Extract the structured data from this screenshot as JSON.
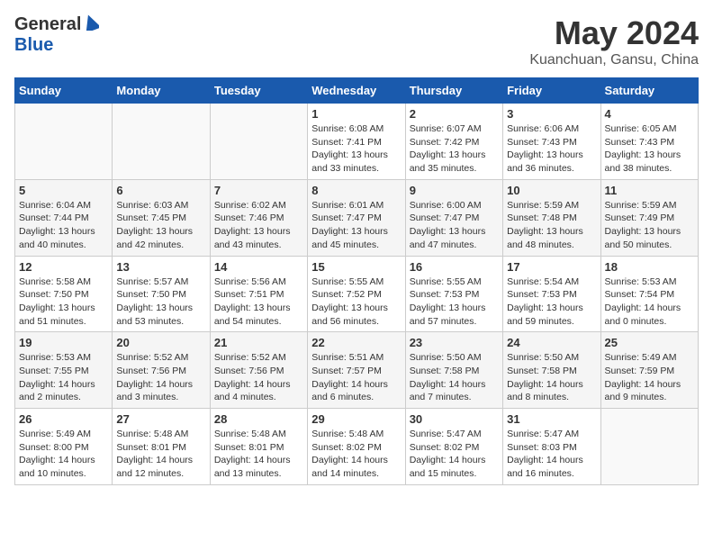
{
  "logo": {
    "general": "General",
    "blue": "Blue"
  },
  "title": {
    "month_year": "May 2024",
    "location": "Kuanchuan, Gansu, China"
  },
  "headers": [
    "Sunday",
    "Monday",
    "Tuesday",
    "Wednesday",
    "Thursday",
    "Friday",
    "Saturday"
  ],
  "weeks": [
    [
      {
        "day": "",
        "info": ""
      },
      {
        "day": "",
        "info": ""
      },
      {
        "day": "",
        "info": ""
      },
      {
        "day": "1",
        "info": "Sunrise: 6:08 AM\nSunset: 7:41 PM\nDaylight: 13 hours\nand 33 minutes."
      },
      {
        "day": "2",
        "info": "Sunrise: 6:07 AM\nSunset: 7:42 PM\nDaylight: 13 hours\nand 35 minutes."
      },
      {
        "day": "3",
        "info": "Sunrise: 6:06 AM\nSunset: 7:43 PM\nDaylight: 13 hours\nand 36 minutes."
      },
      {
        "day": "4",
        "info": "Sunrise: 6:05 AM\nSunset: 7:43 PM\nDaylight: 13 hours\nand 38 minutes."
      }
    ],
    [
      {
        "day": "5",
        "info": "Sunrise: 6:04 AM\nSunset: 7:44 PM\nDaylight: 13 hours\nand 40 minutes."
      },
      {
        "day": "6",
        "info": "Sunrise: 6:03 AM\nSunset: 7:45 PM\nDaylight: 13 hours\nand 42 minutes."
      },
      {
        "day": "7",
        "info": "Sunrise: 6:02 AM\nSunset: 7:46 PM\nDaylight: 13 hours\nand 43 minutes."
      },
      {
        "day": "8",
        "info": "Sunrise: 6:01 AM\nSunset: 7:47 PM\nDaylight: 13 hours\nand 45 minutes."
      },
      {
        "day": "9",
        "info": "Sunrise: 6:00 AM\nSunset: 7:47 PM\nDaylight: 13 hours\nand 47 minutes."
      },
      {
        "day": "10",
        "info": "Sunrise: 5:59 AM\nSunset: 7:48 PM\nDaylight: 13 hours\nand 48 minutes."
      },
      {
        "day": "11",
        "info": "Sunrise: 5:59 AM\nSunset: 7:49 PM\nDaylight: 13 hours\nand 50 minutes."
      }
    ],
    [
      {
        "day": "12",
        "info": "Sunrise: 5:58 AM\nSunset: 7:50 PM\nDaylight: 13 hours\nand 51 minutes."
      },
      {
        "day": "13",
        "info": "Sunrise: 5:57 AM\nSunset: 7:50 PM\nDaylight: 13 hours\nand 53 minutes."
      },
      {
        "day": "14",
        "info": "Sunrise: 5:56 AM\nSunset: 7:51 PM\nDaylight: 13 hours\nand 54 minutes."
      },
      {
        "day": "15",
        "info": "Sunrise: 5:55 AM\nSunset: 7:52 PM\nDaylight: 13 hours\nand 56 minutes."
      },
      {
        "day": "16",
        "info": "Sunrise: 5:55 AM\nSunset: 7:53 PM\nDaylight: 13 hours\nand 57 minutes."
      },
      {
        "day": "17",
        "info": "Sunrise: 5:54 AM\nSunset: 7:53 PM\nDaylight: 13 hours\nand 59 minutes."
      },
      {
        "day": "18",
        "info": "Sunrise: 5:53 AM\nSunset: 7:54 PM\nDaylight: 14 hours\nand 0 minutes."
      }
    ],
    [
      {
        "day": "19",
        "info": "Sunrise: 5:53 AM\nSunset: 7:55 PM\nDaylight: 14 hours\nand 2 minutes."
      },
      {
        "day": "20",
        "info": "Sunrise: 5:52 AM\nSunset: 7:56 PM\nDaylight: 14 hours\nand 3 minutes."
      },
      {
        "day": "21",
        "info": "Sunrise: 5:52 AM\nSunset: 7:56 PM\nDaylight: 14 hours\nand 4 minutes."
      },
      {
        "day": "22",
        "info": "Sunrise: 5:51 AM\nSunset: 7:57 PM\nDaylight: 14 hours\nand 6 minutes."
      },
      {
        "day": "23",
        "info": "Sunrise: 5:50 AM\nSunset: 7:58 PM\nDaylight: 14 hours\nand 7 minutes."
      },
      {
        "day": "24",
        "info": "Sunrise: 5:50 AM\nSunset: 7:58 PM\nDaylight: 14 hours\nand 8 minutes."
      },
      {
        "day": "25",
        "info": "Sunrise: 5:49 AM\nSunset: 7:59 PM\nDaylight: 14 hours\nand 9 minutes."
      }
    ],
    [
      {
        "day": "26",
        "info": "Sunrise: 5:49 AM\nSunset: 8:00 PM\nDaylight: 14 hours\nand 10 minutes."
      },
      {
        "day": "27",
        "info": "Sunrise: 5:48 AM\nSunset: 8:01 PM\nDaylight: 14 hours\nand 12 minutes."
      },
      {
        "day": "28",
        "info": "Sunrise: 5:48 AM\nSunset: 8:01 PM\nDaylight: 14 hours\nand 13 minutes."
      },
      {
        "day": "29",
        "info": "Sunrise: 5:48 AM\nSunset: 8:02 PM\nDaylight: 14 hours\nand 14 minutes."
      },
      {
        "day": "30",
        "info": "Sunrise: 5:47 AM\nSunset: 8:02 PM\nDaylight: 14 hours\nand 15 minutes."
      },
      {
        "day": "31",
        "info": "Sunrise: 5:47 AM\nSunset: 8:03 PM\nDaylight: 14 hours\nand 16 minutes."
      },
      {
        "day": "",
        "info": ""
      }
    ]
  ]
}
